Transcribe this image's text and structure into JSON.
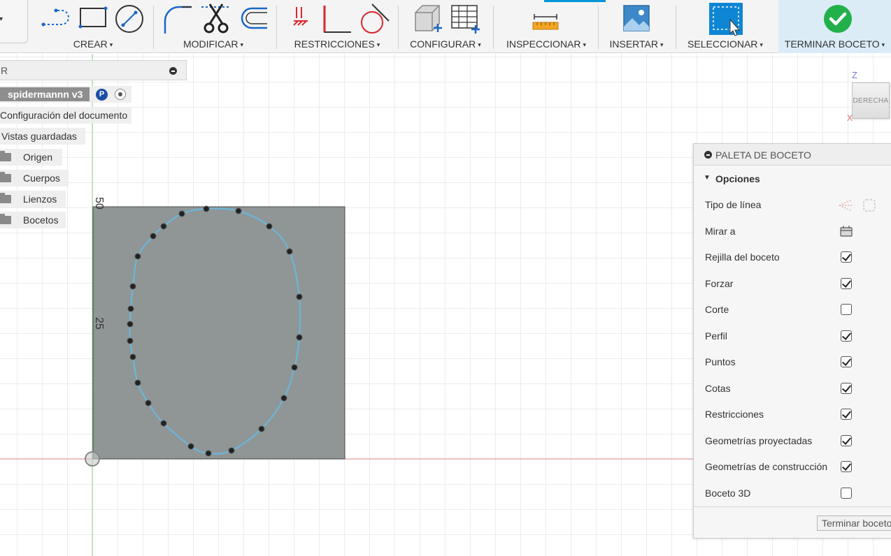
{
  "toolbar": {
    "groups": [
      {
        "label": "CREAR",
        "caret": "▾"
      },
      {
        "label": "MODIFICAR",
        "caret": "▾"
      },
      {
        "label": "RESTRICCIONES",
        "caret": "▾"
      },
      {
        "label": "CONFIGURAR",
        "caret": "▾"
      },
      {
        "label": "INSPECCIONAR",
        "caret": "▾"
      },
      {
        "label": "INSERTAR",
        "caret": "▾"
      },
      {
        "label": "SELECCIONAR",
        "caret": "▾"
      },
      {
        "label": "TERMINAR BOCETO",
        "caret": "▾"
      }
    ],
    "workspace_caret": "▾",
    "colors": {
      "accent": "#0696d7",
      "finish_check": "#22b04b",
      "constraint_red": "#d9252a"
    }
  },
  "browser": {
    "title": "R",
    "root_name": "spidermannn v3",
    "badge": "P",
    "items": [
      {
        "label": "Configuración del documento"
      },
      {
        "label": "Vistas guardadas"
      },
      {
        "label": "Origen"
      },
      {
        "label": "Cuerpos"
      },
      {
        "label": "Lienzos"
      },
      {
        "label": "Bocetos"
      }
    ]
  },
  "viewcube": {
    "face": "DERECHA",
    "z": "Z",
    "x": "X"
  },
  "canvas": {
    "dim_top": "50",
    "dim_mid": "25"
  },
  "palette": {
    "title": "PALETA DE BOCETO",
    "section": "Opciones",
    "rows": [
      {
        "label": "Tipo de línea",
        "control": "icons"
      },
      {
        "label": "Mirar a",
        "control": "icon"
      },
      {
        "label": "Rejilla del boceto",
        "checked": true
      },
      {
        "label": "Forzar",
        "checked": true
      },
      {
        "label": "Corte",
        "checked": false
      },
      {
        "label": "Perfil",
        "checked": true
      },
      {
        "label": "Puntos",
        "checked": true
      },
      {
        "label": "Cotas",
        "checked": true
      },
      {
        "label": "Restricciones",
        "checked": true
      },
      {
        "label": "Geometrías proyectadas",
        "checked": true
      },
      {
        "label": "Geometrías de construcción",
        "checked": true
      },
      {
        "label": "Boceto 3D",
        "checked": false
      }
    ],
    "finish_button": "Terminar boceto"
  }
}
